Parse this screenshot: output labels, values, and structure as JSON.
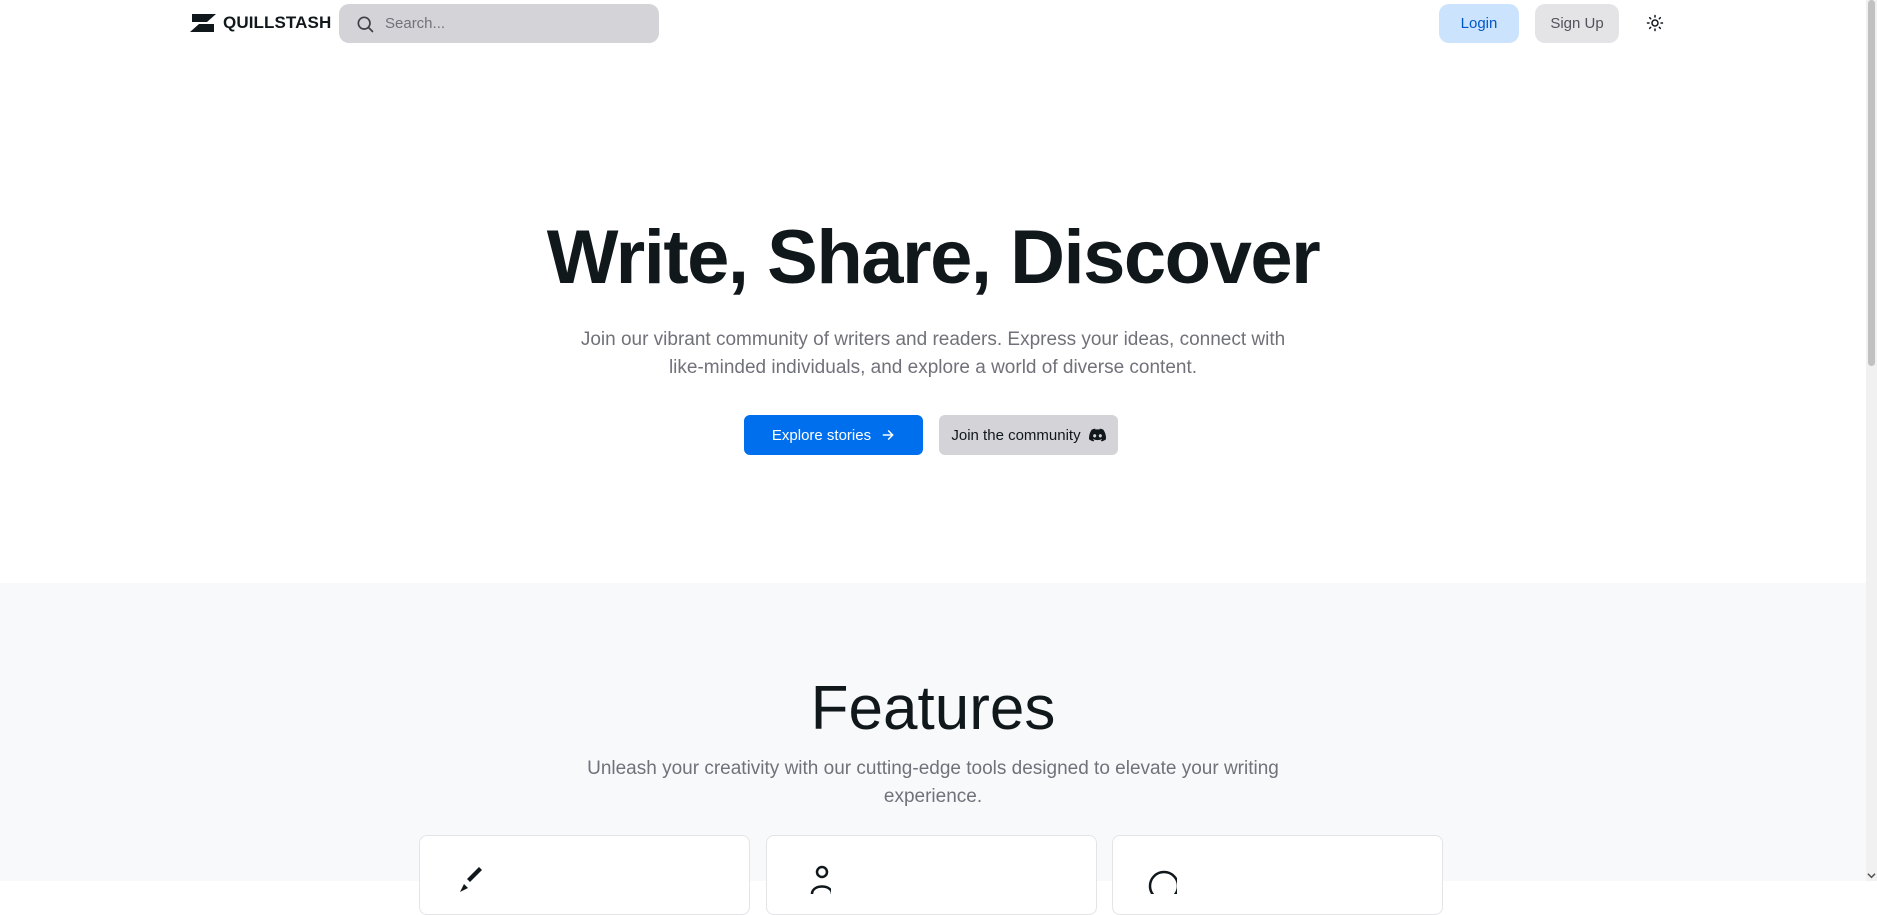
{
  "header": {
    "brand_name": "QUILLSTASH",
    "search_placeholder": "Search...",
    "login_label": "Login",
    "signup_label": "Sign Up",
    "theme_icon": "sun-icon"
  },
  "hero": {
    "title": "Write, Share, Discover",
    "subtitle": "Join our vibrant community of writers and readers. Express your ideas, connect with like-minded individuals, and explore a world of diverse content.",
    "explore_label": "Explore stories",
    "explore_icon": "arrow-right-icon",
    "community_label": "Join the community",
    "community_icon": "discord-icon"
  },
  "features": {
    "title": "Features",
    "subtitle": "Unleash your creativity with our cutting-edge tools designed to elevate your writing experience.",
    "cards": [
      {
        "icon": "pen-icon"
      },
      {
        "icon": "users-icon"
      },
      {
        "icon": "chat-icon"
      }
    ]
  },
  "colors": {
    "primary": "#006fee",
    "primary_soft": "#cce3fd",
    "text": "#11181c",
    "muted_text": "#71717a",
    "section_bg": "#f8f9fb"
  }
}
